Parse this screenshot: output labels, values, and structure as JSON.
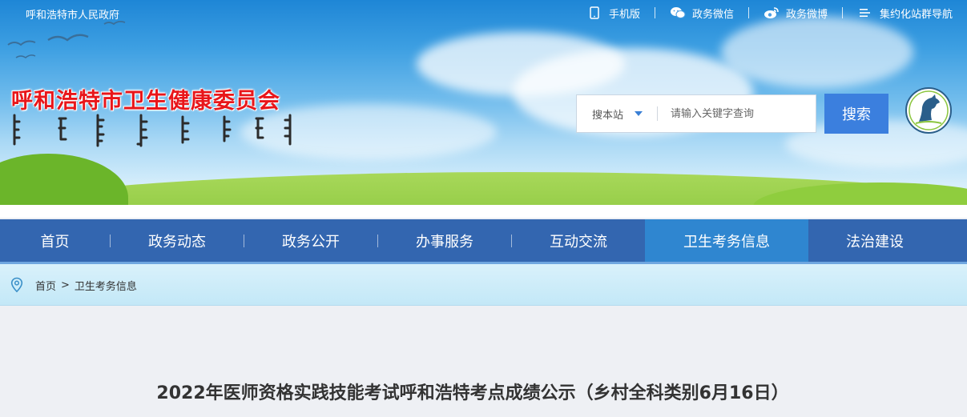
{
  "topbar": {
    "site_name": "呼和浩特市人民政府",
    "links": [
      {
        "label": "手机版",
        "icon": "mobile-icon"
      },
      {
        "label": "政务微信",
        "icon": "wechat-icon"
      },
      {
        "label": "政务微博",
        "icon": "weibo-icon"
      },
      {
        "label": "集约化站群导航",
        "icon": "list-menu-icon"
      }
    ]
  },
  "header": {
    "title": "呼和浩特市卫生健康委员会",
    "emblem_icon": "horse-emblem-icon"
  },
  "search": {
    "scope_label": "搜本站",
    "placeholder": "请输入关键字查询",
    "button_label": "搜索"
  },
  "nav": {
    "items": [
      "首页",
      "政务动态",
      "政务公开",
      "办事服务",
      "互动交流",
      "卫生考务信息",
      "法治建设"
    ],
    "active_index": 5
  },
  "breadcrumb": {
    "icon": "location-pin-icon",
    "home": "首页",
    "separator": ">",
    "current": "卫生考务信息"
  },
  "article": {
    "title": "2022年医师资格实践技能考试呼和浩特考点成绩公示（乡村全科类别6月16日）"
  },
  "colors": {
    "nav_bg": "#3366b0",
    "nav_active": "#2f86d0",
    "search_button": "#3b7fde",
    "title_red": "#e8161a"
  }
}
